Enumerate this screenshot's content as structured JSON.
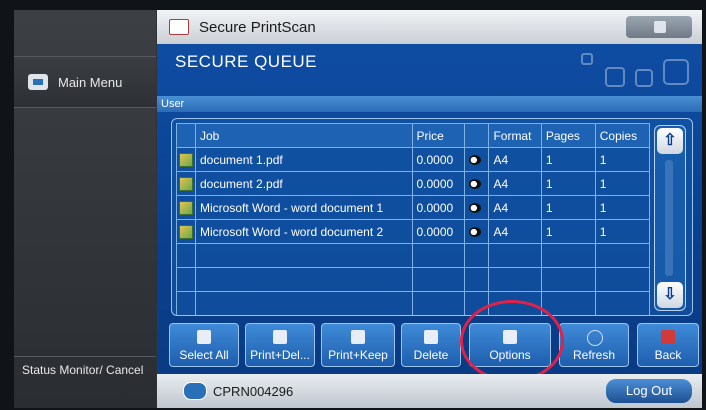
{
  "sidebar": {
    "main_menu_label": "Main Menu",
    "status_label": "Status Monitor/ Cancel"
  },
  "app": {
    "title": "Secure PrintScan"
  },
  "queue": {
    "title": "SECURE QUEUE",
    "user_label": "User",
    "columns": [
      "Job",
      "Price",
      "",
      "Format",
      "Pages",
      "Copies"
    ],
    "rows": [
      {
        "job": "document 1.pdf",
        "price": "0.0000",
        "format": "A4",
        "pages": "1",
        "copies": "1"
      },
      {
        "job": "document 2.pdf",
        "price": "0.0000",
        "format": "A4",
        "pages": "1",
        "copies": "1"
      },
      {
        "job": "Microsoft Word - word document 1",
        "price": "0.0000",
        "format": "A4",
        "pages": "1",
        "copies": "1"
      },
      {
        "job": "Microsoft Word - word document 2",
        "price": "0.0000",
        "format": "A4",
        "pages": "1",
        "copies": "1"
      }
    ]
  },
  "actions": {
    "select_all": "Select All",
    "print_delete": "Print+Del...",
    "print_keep": "Print+Keep",
    "delete": "Delete",
    "options": "Options",
    "refresh": "Refresh",
    "back": "Back"
  },
  "footer": {
    "printer_id": "CPRN004296",
    "logout_label": "Log Out"
  },
  "colors": {
    "accent": "#0a3f8e",
    "highlight": "#e0224a"
  }
}
